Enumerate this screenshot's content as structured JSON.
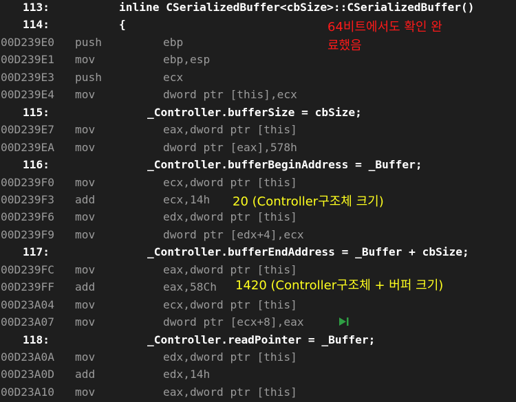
{
  "lines": [
    {
      "type": "src",
      "ln": "113:",
      "code": "inline CSerializedBuffer<cbSize>::CSerializedBuffer()"
    },
    {
      "type": "src",
      "ln": "114:",
      "code": "{"
    },
    {
      "type": "asm",
      "addr": "00D239E0",
      "mn": "push",
      "op": "ebp"
    },
    {
      "type": "asm",
      "addr": "00D239E1",
      "mn": "mov",
      "op": "ebp,esp"
    },
    {
      "type": "asm",
      "addr": "00D239E3",
      "mn": "push",
      "op": "ecx"
    },
    {
      "type": "asm",
      "addr": "00D239E4",
      "mn": "mov",
      "op": "dword ptr [this],ecx"
    },
    {
      "type": "src",
      "ln": "115:",
      "code": "_Controller.bufferSize = cbSize;"
    },
    {
      "type": "asm",
      "addr": "00D239E7",
      "mn": "mov",
      "op": "eax,dword ptr [this]"
    },
    {
      "type": "asm",
      "addr": "00D239EA",
      "mn": "mov",
      "op": "dword ptr [eax],578h"
    },
    {
      "type": "src",
      "ln": "116:",
      "code": "_Controller.bufferBeginAddress = _Buffer;"
    },
    {
      "type": "asm",
      "addr": "00D239F0",
      "mn": "mov",
      "op": "ecx,dword ptr [this]"
    },
    {
      "type": "asm",
      "addr": "00D239F3",
      "mn": "add",
      "op": "ecx,14h"
    },
    {
      "type": "asm",
      "addr": "00D239F6",
      "mn": "mov",
      "op": "edx,dword ptr [this]"
    },
    {
      "type": "asm",
      "addr": "00D239F9",
      "mn": "mov",
      "op": "dword ptr [edx+4],ecx"
    },
    {
      "type": "src",
      "ln": "117:",
      "code": "_Controller.bufferEndAddress = _Buffer + cbSize;"
    },
    {
      "type": "asm",
      "addr": "00D239FC",
      "mn": "mov",
      "op": "eax,dword ptr [this]"
    },
    {
      "type": "asm",
      "addr": "00D239FF",
      "mn": "add",
      "op": "eax,58Ch"
    },
    {
      "type": "asm",
      "addr": "00D23A04",
      "mn": "mov",
      "op": "ecx,dword ptr [this]"
    },
    {
      "type": "asm",
      "addr": "00D23A07",
      "mn": "mov",
      "op": "dword ptr [ecx+8],eax"
    },
    {
      "type": "src",
      "ln": "118:",
      "code": "_Controller.readPointer = _Buffer;"
    },
    {
      "type": "asm",
      "addr": "00D23A0A",
      "mn": "mov",
      "op": "edx,dword ptr [this]"
    },
    {
      "type": "asm",
      "addr": "00D23A0D",
      "mn": "add",
      "op": "edx,14h"
    },
    {
      "type": "asm",
      "addr": "00D23A10",
      "mn": "mov",
      "op": "eax,dword ptr [this]"
    }
  ],
  "annotations": {
    "note_64bit_line1": "64비트에서도 확인 완",
    "note_64bit_line2": "료했음",
    "note_add_14h": "20 (Controller구조체 크기)",
    "note_add_58ch": "1420 (Controller구조체 + 버퍼 크기)"
  },
  "icons": {
    "run_to_cursor": "run-to-click-icon"
  },
  "colors": {
    "background": "#1e1e1e",
    "source_text": "#ffffff",
    "disasm_text": "#9b9b9b",
    "note_red": "#ff1a1a",
    "note_yellow": "#ffff1e",
    "run_arrow": "#2f9e44"
  }
}
